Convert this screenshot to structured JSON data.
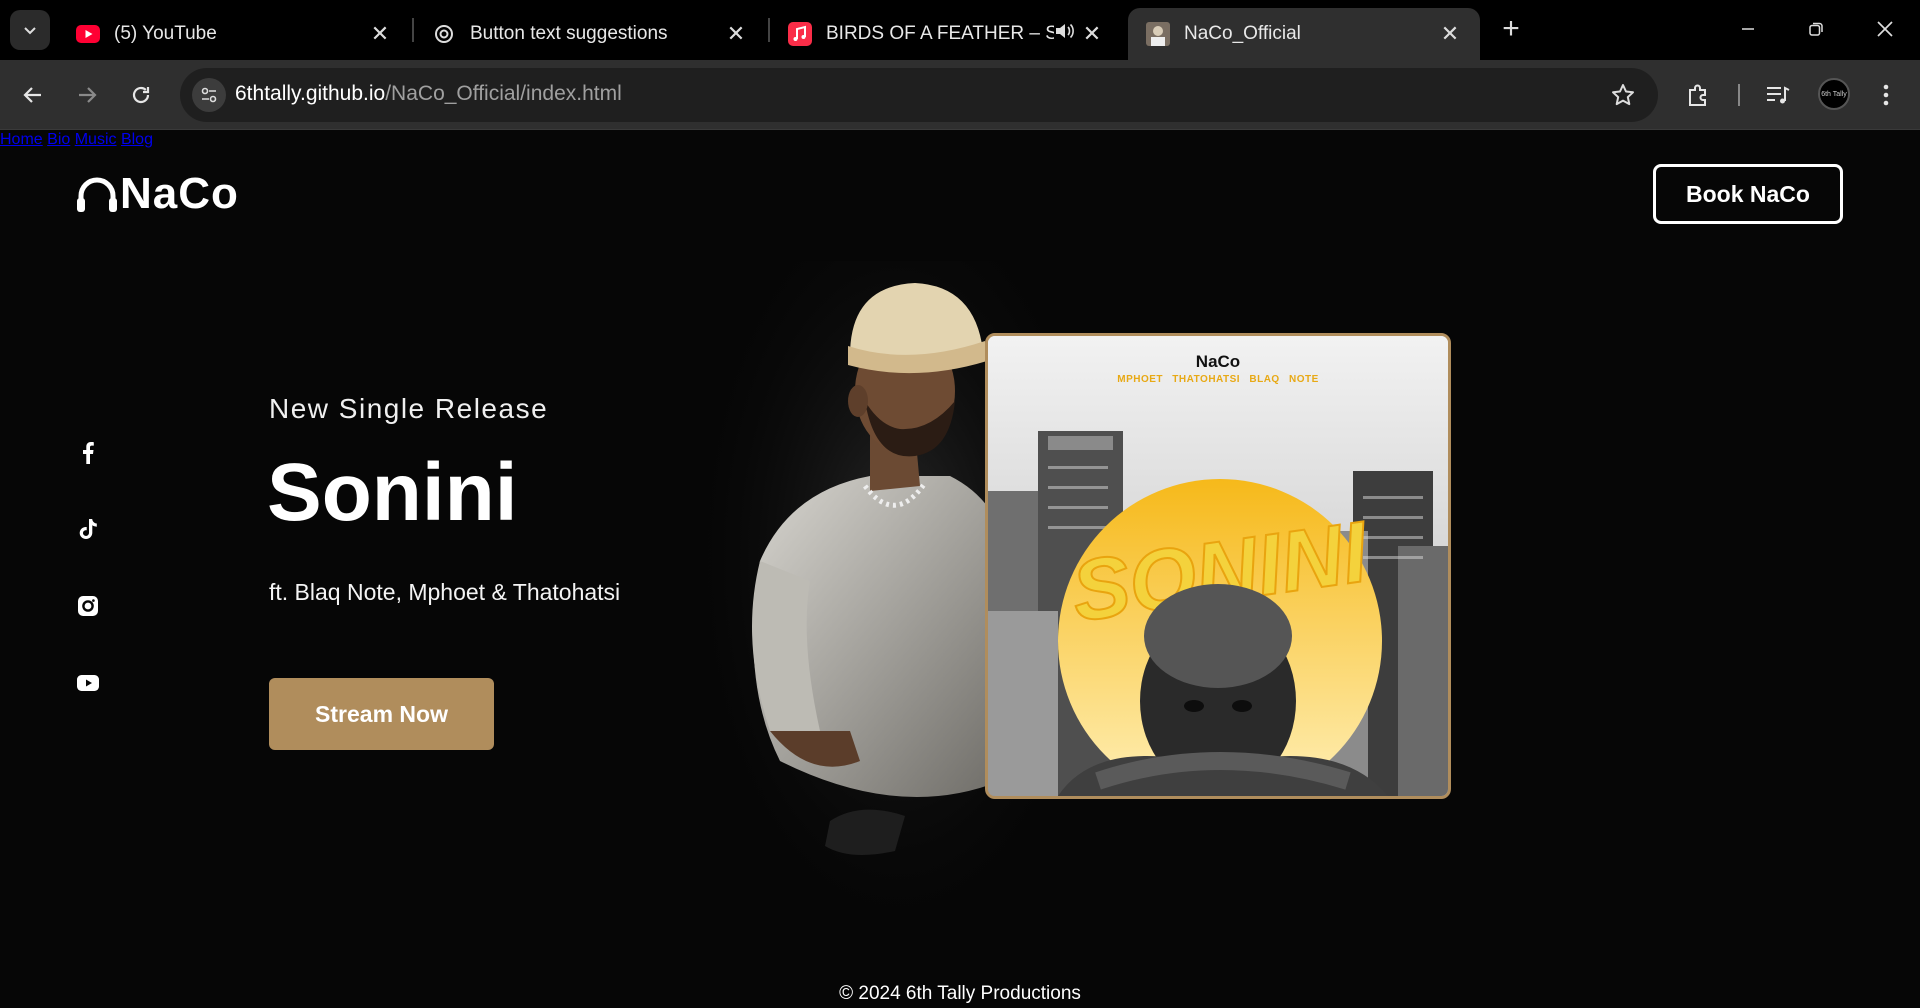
{
  "browser": {
    "tabs": [
      {
        "title": "(5) YouTube",
        "icon": "youtube-icon"
      },
      {
        "title": "Button text suggestions",
        "icon": "chatgpt-icon"
      },
      {
        "title": "BIRDS OF A FEATHER – Song",
        "icon": "apple-music-icon"
      },
      {
        "title": "NaCo_Official",
        "icon": "site-favicon",
        "active": true
      }
    ],
    "url_host": "6thtally.github.io",
    "url_path": "/NaCo_Official/index.html",
    "profile_label": "6th Tally"
  },
  "site": {
    "logo_text": "NaCo",
    "nav": [
      "Home",
      "Bio",
      "Music",
      "Blog"
    ],
    "book_button": "Book NaCo",
    "socials": [
      "facebook-icon",
      "tiktok-icon",
      "instagram-icon",
      "youtube-icon"
    ]
  },
  "hero": {
    "label": "New Single Release",
    "title": "Sonini",
    "featuring": "ft. Blaq Note, Mphoet & Thatohatsi",
    "cta": "Stream Now"
  },
  "cover": {
    "artist": "NaCo",
    "featured": "MPHOET THATOHATSI BLAQ NOTE",
    "title_art": "SONINI"
  },
  "footer": {
    "copyright": "© 2024 6th Tally Productions"
  },
  "colors": {
    "accent": "#b08d5c",
    "background": "#060606",
    "cover_yellow": "#f6b91a"
  }
}
